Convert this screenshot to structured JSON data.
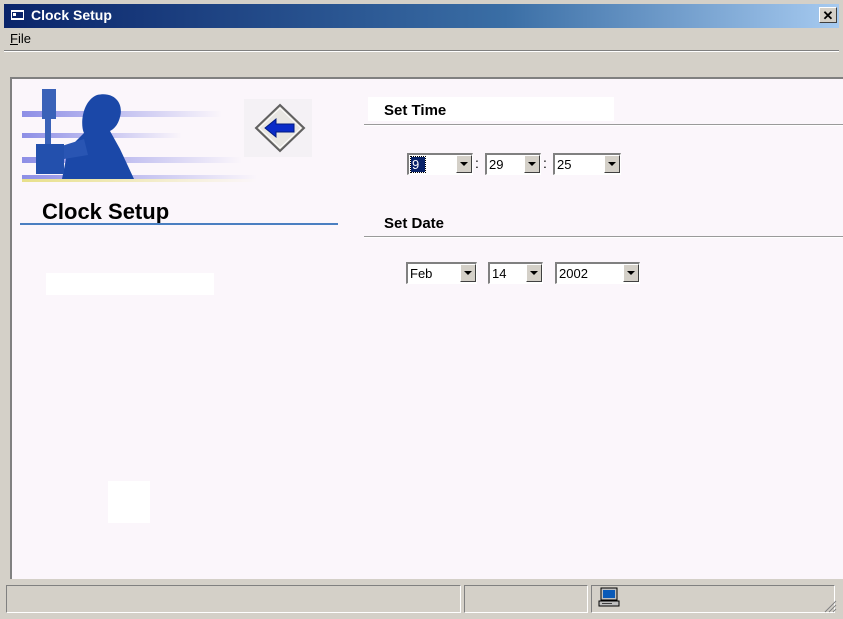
{
  "window": {
    "title": "Clock Setup",
    "close_glyph": "✕"
  },
  "menu": {
    "file_accel": "F",
    "file_rest": "ile"
  },
  "left_panel": {
    "logo_text": "Clock Setup",
    "back_icon": "left-arrow-icon"
  },
  "time": {
    "header": "Set Time",
    "hour": "9",
    "minute": "29",
    "second": "25",
    "separator": ":"
  },
  "date": {
    "header": "Set Date",
    "month": "Feb",
    "day": "14",
    "year": "2002"
  },
  "colors": {
    "titlebar_start": "#0a246a",
    "client_bg": "#fbf6fb",
    "accent_blue": "#1a3a9a",
    "underline": "#4a7fc1"
  },
  "status": {
    "icon": "computer-icon"
  }
}
